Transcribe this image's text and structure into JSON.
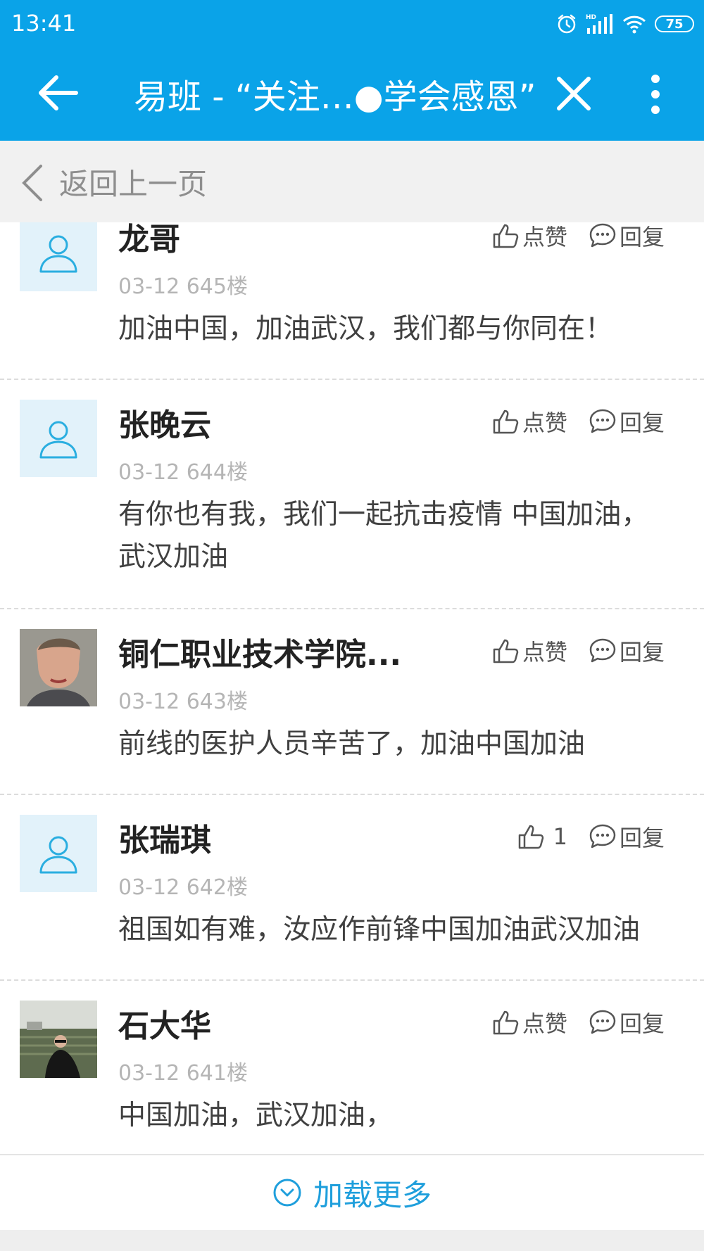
{
  "status_bar": {
    "time": "13:41",
    "battery": "75"
  },
  "header": {
    "title": "易班 - “关注…●学会感恩”"
  },
  "return_bar": {
    "label": "返回上一页"
  },
  "comments": [
    {
      "name": "龙哥",
      "meta": "03-12 645楼",
      "text": "加油中国，加油武汉，我们都与你同在！",
      "like": "点赞",
      "reply": "回复"
    },
    {
      "name": "张晚云",
      "meta": "03-12 644楼",
      "text": "有你也有我，我们一起抗击疫情 中国加油，武汉加油",
      "like": "点赞",
      "reply": "回复"
    },
    {
      "name": "铜仁职业技术学院...",
      "meta": "03-12 643楼",
      "text": "前线的医护人员辛苦了，加油中国加油",
      "like": "点赞",
      "reply": "回复"
    },
    {
      "name": "张瑞琪",
      "meta": "03-12 642楼",
      "text": "祖国如有难，汝应作前锋中国加油武汉加油",
      "like": "1",
      "reply": "回复"
    },
    {
      "name": "石大华",
      "meta": "03-12 641楼",
      "text": "中国加油，武汉加油，",
      "like": "点赞",
      "reply": "回复"
    }
  ],
  "load_more": {
    "label": "加载更多"
  },
  "colors": {
    "header": "#0aa3e8",
    "accent": "#1f9fdc"
  }
}
